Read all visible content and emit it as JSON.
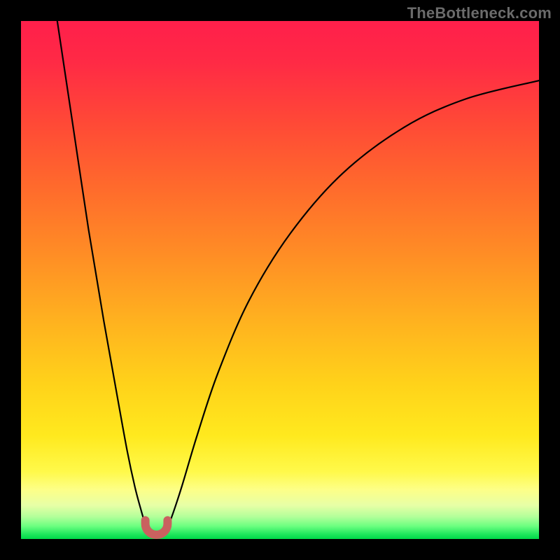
{
  "watermark": {
    "text": "TheBottleneck.com"
  },
  "colors": {
    "gradient_stops": [
      {
        "offset": 0.0,
        "color": "#ff1f4b"
      },
      {
        "offset": 0.08,
        "color": "#ff2a45"
      },
      {
        "offset": 0.2,
        "color": "#ff4a36"
      },
      {
        "offset": 0.32,
        "color": "#ff6a2c"
      },
      {
        "offset": 0.45,
        "color": "#ff8d25"
      },
      {
        "offset": 0.58,
        "color": "#ffb21f"
      },
      {
        "offset": 0.7,
        "color": "#ffd21a"
      },
      {
        "offset": 0.8,
        "color": "#ffe91e"
      },
      {
        "offset": 0.87,
        "color": "#fff94a"
      },
      {
        "offset": 0.905,
        "color": "#fdff88"
      },
      {
        "offset": 0.935,
        "color": "#e7ffa6"
      },
      {
        "offset": 0.957,
        "color": "#b3ff9a"
      },
      {
        "offset": 0.975,
        "color": "#6cff80"
      },
      {
        "offset": 0.99,
        "color": "#22e85e"
      },
      {
        "offset": 1.0,
        "color": "#00d848"
      }
    ],
    "curve": "#000000",
    "marker_fill": "#c9615f",
    "marker_stroke": "#c9615f",
    "frame": "#000000"
  },
  "chart_data": {
    "type": "line",
    "title": "",
    "xlabel": "",
    "ylabel": "",
    "xlim": [
      0,
      100
    ],
    "ylim": [
      0,
      100
    ],
    "grid": false,
    "legend": false,
    "note": "No axis ticks or numeric labels are rendered; values are visual estimates from curve geometry (0–100 normalized).",
    "series": [
      {
        "name": "left-branch",
        "x": [
          7.0,
          10.0,
          13.0,
          16.0,
          18.5,
          20.5,
          22.0,
          23.2,
          24.0,
          24.6
        ],
        "values": [
          100.0,
          80.0,
          60.0,
          42.0,
          28.0,
          17.0,
          10.0,
          5.5,
          2.8,
          1.2
        ]
      },
      {
        "name": "right-branch",
        "x": [
          27.8,
          29.0,
          31.0,
          34.0,
          38.0,
          44.0,
          52.0,
          62.0,
          74.0,
          86.0,
          100.0
        ],
        "values": [
          1.2,
          4.0,
          10.0,
          20.0,
          32.0,
          46.0,
          59.0,
          70.5,
          79.5,
          85.0,
          88.5
        ]
      }
    ],
    "marker": {
      "name": "u-marker",
      "shape": "U",
      "x_range": [
        24.0,
        28.3
      ],
      "y_range": [
        0.0,
        3.6
      ],
      "stroke_width_px": 12
    }
  }
}
